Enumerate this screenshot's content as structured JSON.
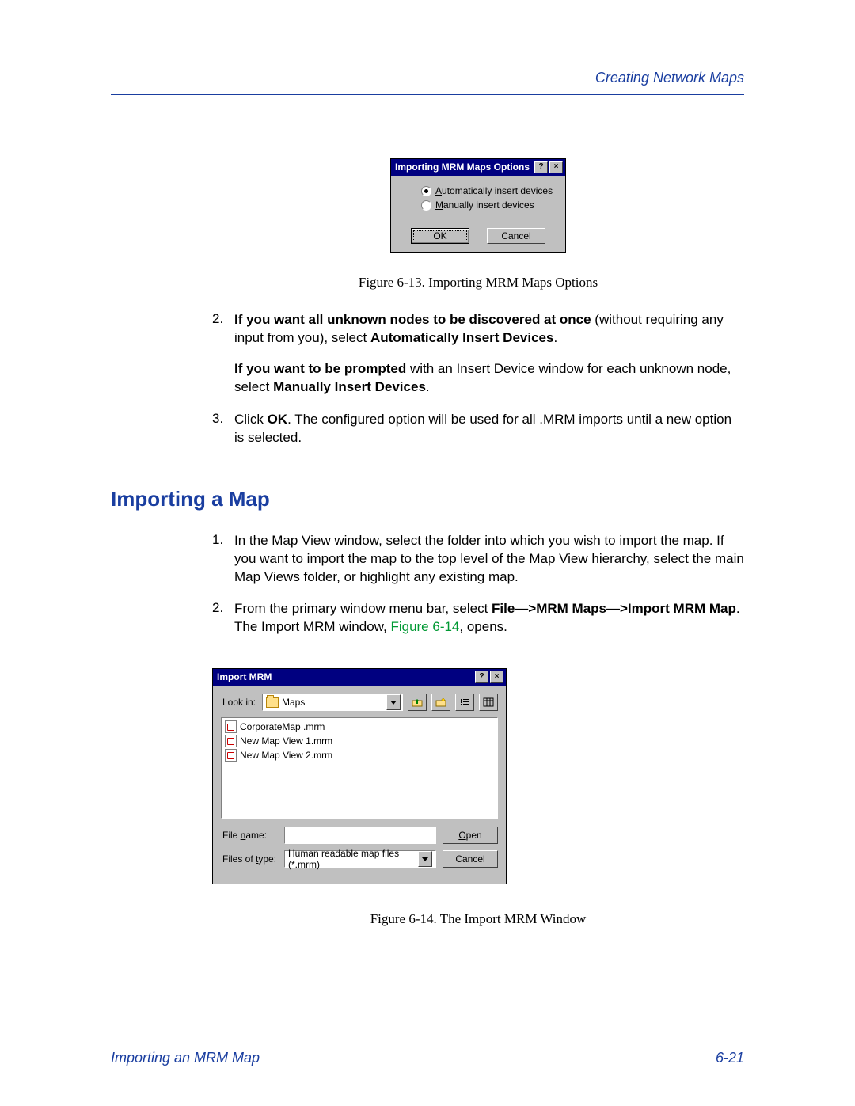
{
  "header": {
    "section": "Creating Network Maps"
  },
  "figure13": {
    "title": "Importing MRM Maps Options",
    "radio1": "Automatically insert devices",
    "radio2": "Manually insert devices",
    "ok": "OK",
    "cancel": "Cancel",
    "caption": "Figure 6-13.  Importing MRM Maps Options"
  },
  "steps1": {
    "s2_a": "If you want all unknown nodes to be discovered at once",
    "s2_b": " (without requiring any input from you), select ",
    "s2_c": "Automatically Insert Devices",
    "s2_d": ".",
    "s2p2_a": "If you want to be prompted",
    "s2p2_b": " with an Insert Device window for each unknown node, select ",
    "s2p2_c": "Manually Insert Devices",
    "s2p2_d": ".",
    "s3_a": "Click ",
    "s3_b": "OK",
    "s3_c": ". The configured option will be used for all .MRM imports until a new option is selected."
  },
  "h2": "Importing a Map",
  "steps2": {
    "s1": "In the Map View window, select the folder into which you wish to import the map. If you want to import the map to the top level of the Map View hierarchy, select the main Map Views folder, or highlight any existing map.",
    "s2_a": "From the primary window menu bar, select ",
    "s2_b": "File—>MRM Maps—>Import MRM Map",
    "s2_c": ". The Import MRM window, ",
    "s2_d": "Figure 6-14",
    "s2_e": ", opens."
  },
  "figure14": {
    "title": "Import MRM",
    "lookin_label": "Look in:",
    "lookin_value": "Maps",
    "files": [
      "CorporateMap .mrm",
      "New Map View 1.mrm",
      "New Map View 2.mrm"
    ],
    "filename_label": "File name:",
    "filename_value": "",
    "filetype_label": "Files of type:",
    "filetype_value": "Human readable map files (*.mrm)",
    "open": "Open",
    "cancel": "Cancel",
    "caption": "Figure 6-14.  The Import MRM Window"
  },
  "footer": {
    "left": "Importing an MRM Map",
    "right": "6-21"
  }
}
